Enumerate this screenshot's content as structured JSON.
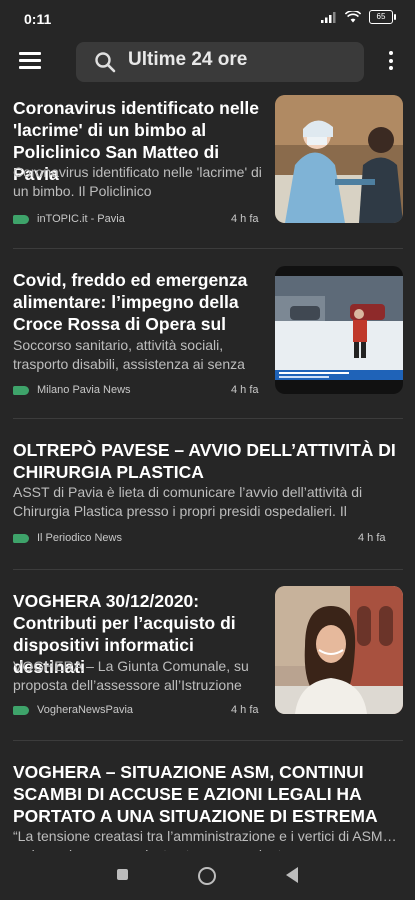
{
  "status_bar": {
    "time": "0:11",
    "battery": "65"
  },
  "header": {
    "search_text": "Ultime 24 ore"
  },
  "articles": [
    {
      "title": "Coronavirus identificato nelle 'lacrime' di un bimbo al Policlinico San Matteo di Pavia",
      "snippet": "Coronavirus identificato nelle 'lacrime' di un bimbo. Il Policlinico",
      "source": "inTOPIC.it - Pavia",
      "ago": "4 h fa"
    },
    {
      "title": "Covid, freddo ed emergenza alimentare: l’impegno della Croce Rossa di Opera sul",
      "snippet": "Soccorso sanitario, attività sociali, trasporto disabili, assistenza ai senza",
      "source": "Milano Pavia News",
      "ago": "4 h fa"
    },
    {
      "title": "OLTREPÒ PAVESE – AVVIO DELL’ATTIVITÀ DI CHIRURGIA PLASTICA",
      "snippet": "ASST di Pavia è lieta di comunicare l’avvio dell’attività di Chirurgia Plastica presso i propri presidi ospedalieri. Il",
      "source": "Il Periodico News",
      "ago": "4 h fa"
    },
    {
      "title": "VOGHERA 30/12/2020: Contributi per l’acquisto di dispositivi informatici destinati",
      "snippet": "VOGHERA – La Giunta Comunale, su proposta dell’assessore all’Istruzione",
      "source": "VogheraNewsPavia",
      "ago": "4 h fa"
    },
    {
      "title": "VOGHERA – SITUAZIONE ASM, CONTINUI SCAMBI DI ACCUSE E AZIONI LEGALI HA PORTATO A UNA SITUAZIONE DI ESTREMA",
      "snippet": "“La tensione creatasi tra l’amministrazione e i vertici di ASM… scrivono in un comunicato stampa congiunto"
    }
  ],
  "colors": {
    "background": "#262626",
    "source_icon": "#3ea36a",
    "search_bg": "#3a3a3a"
  },
  "icons": [
    "menu-icon",
    "search-icon",
    "more-vert-icon",
    "signal-icon",
    "wifi-icon",
    "battery-icon",
    "nav-recents-icon",
    "nav-home-icon",
    "nav-back-icon"
  ]
}
